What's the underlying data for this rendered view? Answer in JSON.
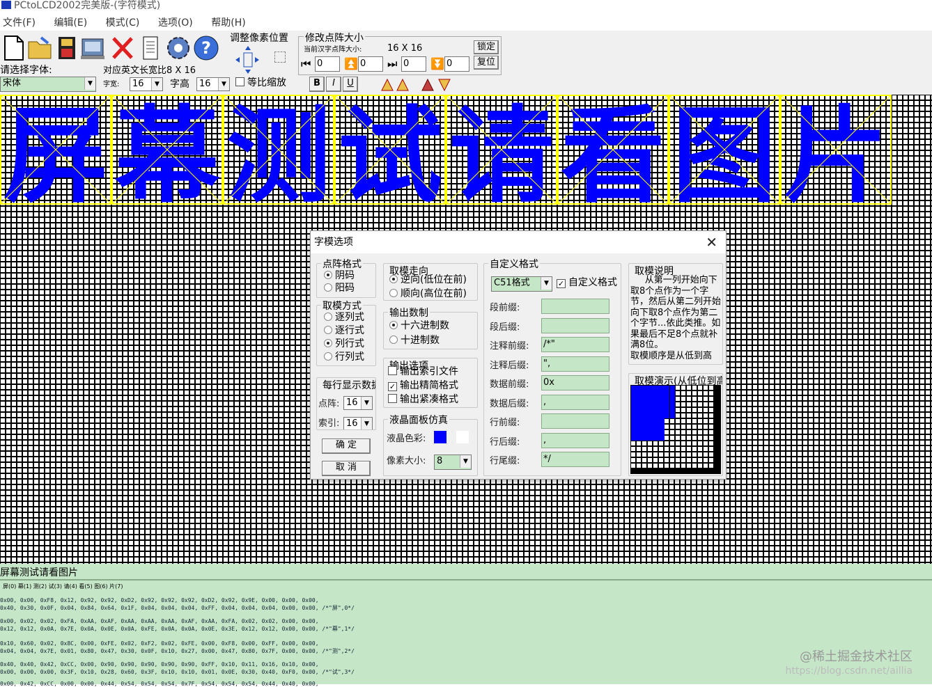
{
  "window": {
    "title": "PCtoLCD2002完美版-(字符模式)"
  },
  "menu": [
    "文件(F)",
    "编辑(E)",
    "模式(C)",
    "选项(O)",
    "帮助(H)"
  ],
  "toolbar": {
    "font_prompt": "请选择字体:",
    "font_value": "宋体",
    "ratio_label": "对应英文长宽比8 X 16",
    "char_width_label": "字宽:",
    "char_width_value": "16",
    "char_height_label": "字高",
    "char_height_value": "16",
    "proportional_label": "等比缩放",
    "adjust_pixel_label": "调整像素位置",
    "resize_label": "修改点阵大小",
    "current_matrix_label": "当前汉字点阵大小:",
    "current_matrix_value": "16 X 16",
    "lock_label": "锁定",
    "reset_label": "复位",
    "spin_values": [
      "0",
      "0",
      "0",
      "0"
    ],
    "bold": "B",
    "italic": "I",
    "underline": "U"
  },
  "display_text": "屏幕测试请看图片",
  "status_text": "屏幕测试请看图片",
  "code_tabs": "屏(0) 幕(1) 测(2) 试(3) 请(4) 看(5) 图(6) 片(7)",
  "code_lines": [
    "0x00, 0x00, 0xF8, 0x12, 0x92, 0x92, 0xD2, 0x92, 0x92, 0x92, 0xD2, 0x92, 0x9E, 0x00, 0x00, 0x00,",
    "0x40, 0x30, 0x0F, 0x04, 0x84, 0x64, 0x1F, 0x04, 0x04, 0x04, 0xFF, 0x04, 0x04, 0x04, 0x00, 0x00, /*\"屏\",0*/",
    "0x00, 0x02, 0x02, 0xFA, 0xAA, 0xAF, 0xAA, 0xAA, 0xAA, 0xAF, 0xAA, 0xFA, 0x02, 0x02, 0x00, 0x00,",
    "0x12, 0x12, 0x0A, 0x7E, 0x0A, 0x0E, 0x0A, 0xFE, 0x0A, 0x0A, 0x0E, 0x3E, 0x12, 0x12, 0x00, 0x00, /*\"幕\",1*/",
    "0x10, 0x60, 0x02, 0x8C, 0x00, 0xFE, 0x02, 0xF2, 0x02, 0xFE, 0x00, 0xF8, 0x00, 0xFF, 0x00, 0x00,",
    "0x04, 0x04, 0x7E, 0x01, 0x80, 0x47, 0x30, 0x0F, 0x10, 0x27, 0x00, 0x47, 0x80, 0x7F, 0x00, 0x00, /*\"测\",2*/",
    "0x40, 0x40, 0x42, 0xCC, 0x00, 0x90, 0x90, 0x90, 0x90, 0x90, 0xFF, 0x10, 0x11, 0x16, 0x10, 0x00,",
    "0x00, 0x00, 0x00, 0x3F, 0x10, 0x28, 0x60, 0x3F, 0x10, 0x10, 0x01, 0x0E, 0x30, 0x40, 0xF0, 0x00, /*\"试\",3*/",
    "0x00, 0x42, 0xCC, 0x00, 0x00, 0x44, 0x54, 0x54, 0x54, 0x7F, 0x54, 0x54, 0x54, 0x44, 0x40, 0x00,"
  ],
  "dialog": {
    "title": "字模选项",
    "matrix_format": {
      "legend": "点阵格式",
      "options": [
        "阴码",
        "阳码"
      ],
      "selected": 0
    },
    "scan_mode": {
      "legend": "取模方式",
      "options": [
        "逐列式",
        "逐行式",
        "列行式",
        "行列式"
      ],
      "selected": 2
    },
    "per_line": {
      "legend": "每行显示数据",
      "dots_label": "点阵:",
      "dots_value": "16",
      "index_label": "索引:",
      "index_value": "16"
    },
    "ok_button": "确 定",
    "cancel_button": "取 消",
    "direction": {
      "legend": "取模走向",
      "options": [
        "逆向(低位在前)",
        "顺向(高位在前)"
      ],
      "selected": 0
    },
    "radix": {
      "legend": "输出数制",
      "options": [
        "十六进制数",
        "十进制数"
      ],
      "selected": 0
    },
    "output_opts": {
      "legend": "输出选项",
      "items": [
        {
          "label": "输出索引文件",
          "checked": false
        },
        {
          "label": "输出精简格式",
          "checked": true
        },
        {
          "label": "输出紧凑格式",
          "checked": false
        }
      ]
    },
    "lcd_sim": {
      "legend": "液晶面板仿真",
      "color_label": "液晶色彩:",
      "lcd_color": "#0000ff",
      "bg_color": "#ffffff",
      "pixel_label": "像素大小:",
      "pixel_value": "8"
    },
    "custom_format": {
      "legend": "自定义格式",
      "format_value": "C51格式",
      "custom_check_label": "自定义格式",
      "custom_checked": true,
      "fields": [
        {
          "label": "段前缀:",
          "value": ""
        },
        {
          "label": "段后缀:",
          "value": ""
        },
        {
          "label": "注释前缀:",
          "value": "/*\""
        },
        {
          "label": "注释后缀:",
          "value": "\","
        },
        {
          "label": "数据前缀:",
          "value": "0x"
        },
        {
          "label": "数据后缀:",
          "value": ","
        },
        {
          "label": "行前缀:",
          "value": ""
        },
        {
          "label": "行后缀:",
          "value": ","
        },
        {
          "label": "行尾缀:",
          "value": "*/"
        }
      ]
    },
    "explain": {
      "legend": "取模说明",
      "text": "从第一列开始向下取8个点作为一个字节，然后从第二列开始向下取8个点作为第二个字节...依此类推。如果最后不足8个点就补满8位。\n取模顺序是从低到高"
    },
    "demo": {
      "legend": "取模演示(从低位到高位)"
    }
  },
  "watermark": {
    "line1": "@稀土掘金技术社区",
    "line2": "https://blog.csdn.net/aillia"
  },
  "colors": {
    "lcd_blue": "#0000ff",
    "highlight_yellow": "#ffff00",
    "panel_green": "#c6e6c8"
  }
}
